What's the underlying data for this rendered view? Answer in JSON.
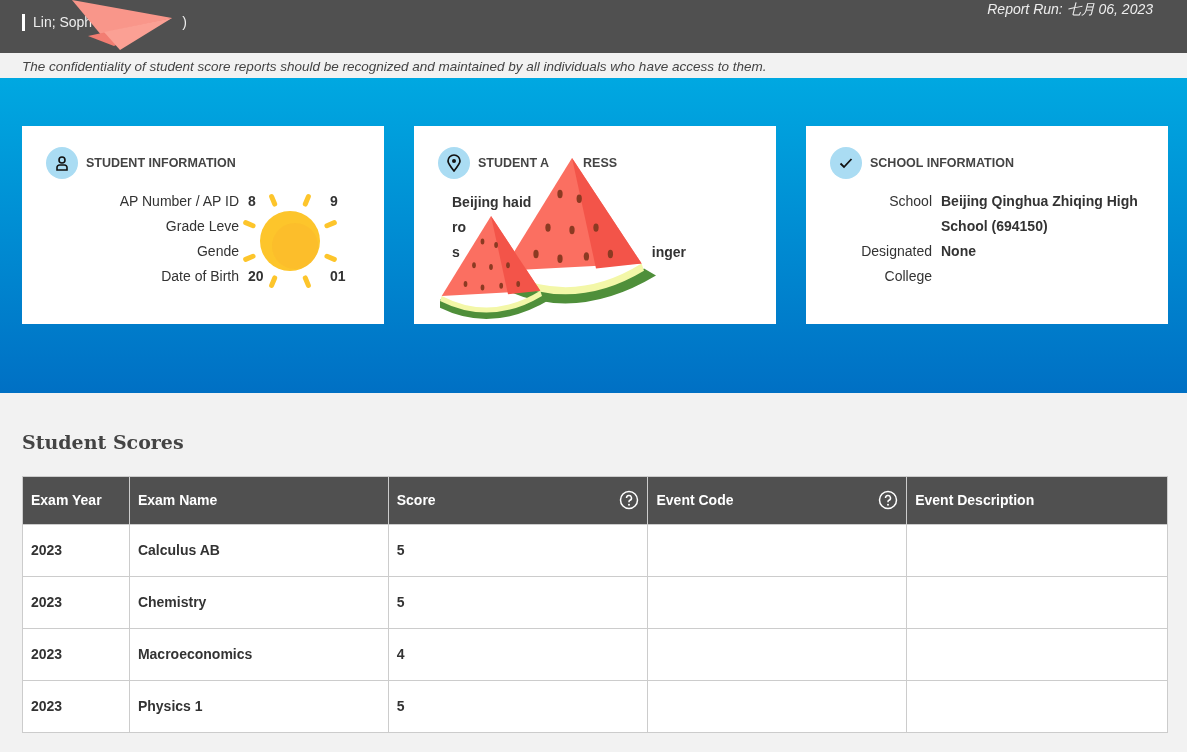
{
  "header": {
    "name": "Lin; Soph",
    "name_tail": ")",
    "report_run": "Report Run: 七月 06, 2023"
  },
  "notice": "The confidentiality of student score reports should be recognized and maintained by all individuals who have access to them.",
  "cards": [
    {
      "kind": "person",
      "title": "STUDENT INFORMATION",
      "rows": [
        {
          "label": "AP Number / AP ID",
          "value": "8",
          "tail": "9"
        },
        {
          "label": "Grade Leve"
        },
        {
          "label": "Gende"
        },
        {
          "label": "Date of Birth",
          "value": "20",
          "tail": "01"
        }
      ]
    },
    {
      "kind": "address",
      "title": "STUDENT A",
      "title_tail": "RESS",
      "lines": [
        {
          "text": "Beijing haid"
        },
        {
          "text": "ro"
        },
        {
          "text": "s",
          "tail": "inger"
        }
      ]
    },
    {
      "kind": "check",
      "title": "SCHOOL INFORMATION",
      "rows": [
        {
          "label": "School",
          "value": "Beijing Qinghua Zhiqing High School (694150)"
        },
        {
          "label": "Designated College",
          "value": "None"
        }
      ]
    }
  ],
  "scores": {
    "title": "Student Scores",
    "columns": [
      {
        "label": "Exam Year",
        "help": false
      },
      {
        "label": "Exam Name",
        "help": false
      },
      {
        "label": "Score",
        "help": true
      },
      {
        "label": "Event Code",
        "help": true
      },
      {
        "label": "Event Description",
        "help": false
      }
    ],
    "rows": [
      {
        "year": "2023",
        "exam": "Calculus AB",
        "score": "5"
      },
      {
        "year": "2023",
        "exam": "Chemistry",
        "score": "5"
      },
      {
        "year": "2023",
        "exam": "Macroeconomics",
        "score": "4"
      },
      {
        "year": "2023",
        "exam": "Physics 1",
        "score": "5"
      }
    ]
  }
}
